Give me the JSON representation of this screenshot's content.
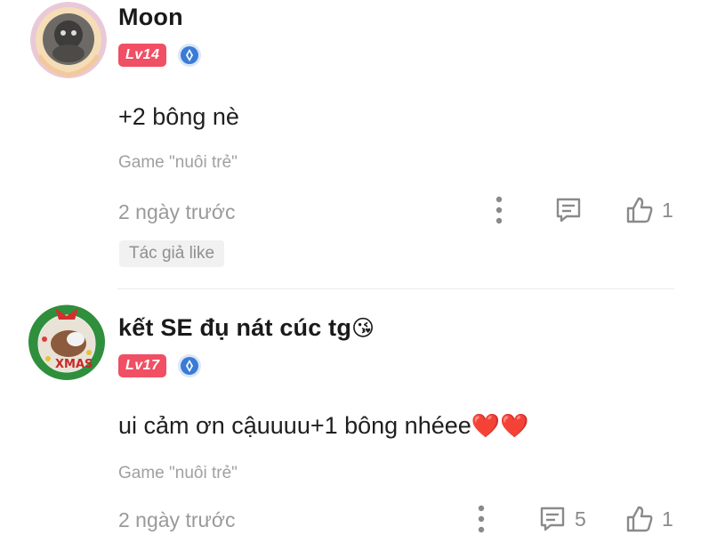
{
  "comments": [
    {
      "username": "Moon",
      "level": "Lv14",
      "content": "+2 bông nè",
      "source": "Game \"nuôi trẻ\"",
      "time": "2 ngày trước",
      "reply_count": "",
      "like_count": "1",
      "author_like": "Tác giả like"
    },
    {
      "username": "kết SE đụ nát cúc tg",
      "username_emoji": "😘",
      "level": "Lv17",
      "content": "ui cảm ơn cậuuuu+1 bông nhéee",
      "content_emoji": "❤️❤️",
      "source": "Game \"nuôi trẻ\"",
      "time": "2 ngày trước",
      "reply_count": "5",
      "like_count": "1"
    }
  ],
  "colors": {
    "level_badge": "#f04f64",
    "verified_badge": "#3a7bd5",
    "muted_text": "#9a9a9a"
  },
  "icons": [
    "more-vertical-icon",
    "comment-icon",
    "thumbs-up-icon",
    "verified-icon"
  ]
}
